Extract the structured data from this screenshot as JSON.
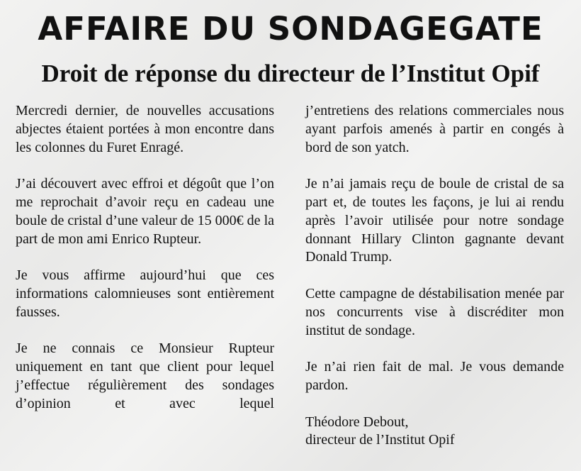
{
  "header": {
    "title": "AFFAIRE DU SONDAGEGATE",
    "subtitle": "Droit de réponse du directeur de l’Institut Opif"
  },
  "body": {
    "paragraphs": [
      "Mercredi dernier, de nouvelles accusations abjectes étaient portées à mon encontre dans les colonnes du Furet Enragé.",
      "J’ai découvert avec effroi et dégoût que l’on me reprochait d’avoir reçu en cadeau une boule de cristal d’une valeur de 15 000€ de la part de mon ami Enrico Rupteur.",
      "Je vous affirme aujourd’hui que ces informations calomnieuses sont entièrement fausses.",
      "Je ne connais ce Monsieur Rupteur uniquement en tant que client pour lequel j’effectue régulièrement des sondages d’opinion et avec lequel",
      "j’entretiens des relations commerciales nous ayant parfois amenés à partir en congés à bord de son yatch.",
      "Je n’ai jamais reçu de boule de cristal de sa part et, de toutes les façons, je lui ai rendu après l’avoir utilisée pour notre sondage donnant Hillary Clinton gagnante devant Donald Trump.",
      "Cette campagne de déstabilisation menée par nos concurrents vise à discréditer mon institut de sondage.",
      "Je n’ai rien fait de mal. Je vous demande pardon."
    ],
    "signature": {
      "name": "Théodore Debout,",
      "role": "directeur de l’Institut Opif"
    }
  }
}
